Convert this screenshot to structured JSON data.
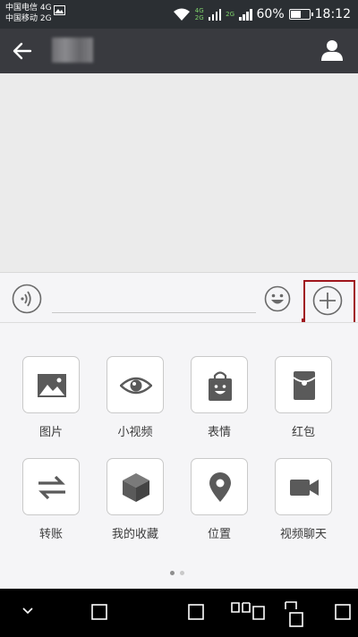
{
  "status_bar": {
    "carrier_1": "中国电信 4G",
    "carrier_2": "中国移动 2G",
    "network_top": "4G",
    "network_bottom": "2G",
    "network_sim2": "2G",
    "battery_percent": "60%",
    "time": "18:12",
    "battery_level": 0.6,
    "icons": [
      "image-icon",
      "wifi-icon",
      "signal-icon",
      "battery-icon"
    ]
  },
  "header": {
    "back_icon": "arrow-left-icon",
    "contact_name": "",
    "profile_icon": "user-icon"
  },
  "input_bar": {
    "voice_icon": "voice-icon",
    "emoji_icon": "smiley-icon",
    "more_icon": "plus-circle-icon",
    "highlight_color": "#a0161d"
  },
  "panel": {
    "items": [
      {
        "label": "图片",
        "icon": "image-icon"
      },
      {
        "label": "小视频",
        "icon": "eye-icon"
      },
      {
        "label": "表情",
        "icon": "sticker-bag-icon"
      },
      {
        "label": "红包",
        "icon": "red-packet-icon"
      },
      {
        "label": "转账",
        "icon": "transfer-icon"
      },
      {
        "label": "我的收藏",
        "icon": "cube-icon"
      },
      {
        "label": "位置",
        "icon": "location-pin-icon"
      },
      {
        "label": "视频聊天",
        "icon": "video-camera-icon"
      }
    ],
    "page_indicator": {
      "total": 2,
      "current": 1
    }
  },
  "nav_bar": {
    "icons": [
      "chevron-down-icon",
      "square-icon",
      "square-icon",
      "multi-window-icon",
      "split-screen-icon",
      "square-icon"
    ]
  },
  "colors": {
    "header_bg": "#393a3f",
    "chat_bg": "#ebebeb",
    "panel_bg": "#f5f5f7",
    "icon_gray": "#5a5a5a"
  }
}
